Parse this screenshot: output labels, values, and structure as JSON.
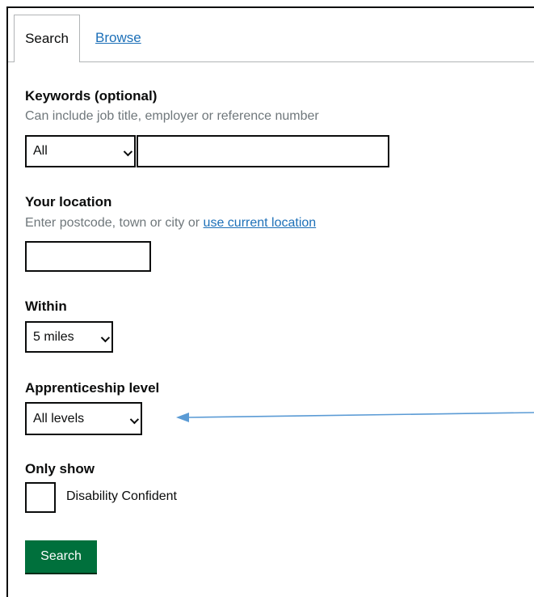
{
  "tabs": {
    "search_label": "Search",
    "browse_label": "Browse"
  },
  "keywords": {
    "label": "Keywords (optional)",
    "hint": "Can include job title, employer or reference number",
    "scope_value": "All",
    "text_value": ""
  },
  "location": {
    "label": "Your location",
    "hint_prefix": "Enter postcode, town or city or ",
    "hint_link": "use current location",
    "value": ""
  },
  "within": {
    "label": "Within",
    "value": "5 miles"
  },
  "level": {
    "label": "Apprenticeship level",
    "value": "All levels"
  },
  "only_show": {
    "label": "Only show",
    "checkbox_label": "Disability Confident",
    "checked": false
  },
  "submit": {
    "label": "Search"
  },
  "colors": {
    "link": "#1d70b8",
    "button": "#00703c",
    "annotation_arrow": "#5b9bd5"
  }
}
